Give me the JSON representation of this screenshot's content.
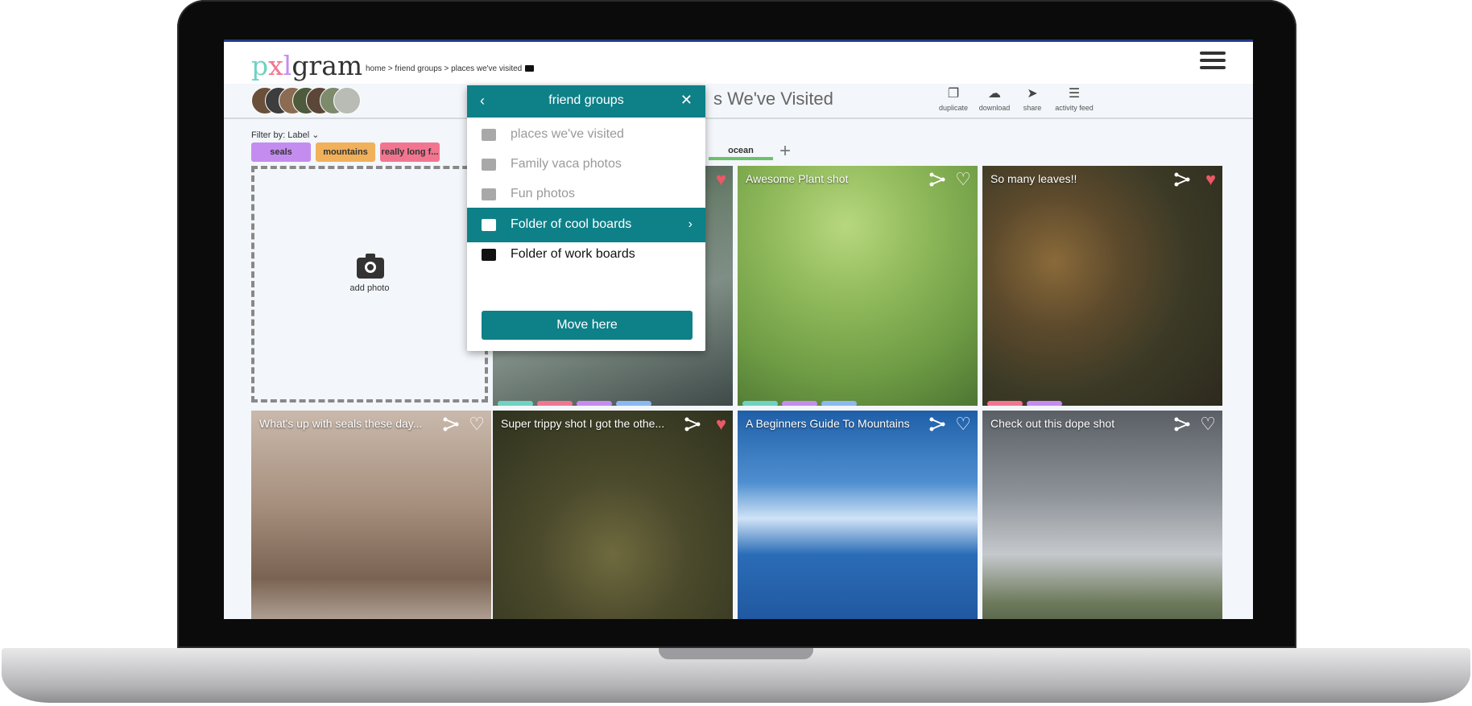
{
  "logo": {
    "p": "p",
    "x": "x",
    "l": "l",
    "g": "gram"
  },
  "breadcrumb": "home > friend groups > places we've visited",
  "board": {
    "title": "s We've Visited"
  },
  "toolbar": [
    {
      "label": "duplicate",
      "icon": "duplicate-icon"
    },
    {
      "label": "download",
      "icon": "cloud-download-icon"
    },
    {
      "label": "share",
      "icon": "share-icon"
    },
    {
      "label": "activity feed",
      "icon": "activity-feed-icon"
    }
  ],
  "filter": {
    "label": "Filter by: Label"
  },
  "labels": [
    {
      "text": "seals",
      "color": "#c58cf0"
    },
    {
      "text": "mountains",
      "color": "#f0b15a"
    },
    {
      "text": "really long f...",
      "color": "#f27590"
    },
    {
      "text": "ocean",
      "color": "#6cc26b"
    }
  ],
  "add_photo": {
    "label": "add photo"
  },
  "tiles": [
    {
      "title": "",
      "liked": true,
      "chips": [
        "#6fd2c2",
        "#f27590",
        "#c58cf0",
        "#8bb8f0"
      ]
    },
    {
      "title": "Awesome Plant shot",
      "liked": false,
      "chips": [
        "#6fd2c2",
        "#c58cf0",
        "#8bb8f0"
      ]
    },
    {
      "title": "So many leaves!!",
      "liked": true,
      "chips": [
        "#f27590",
        "#c58cf0"
      ]
    },
    {
      "title": "What's up with seals these day...",
      "liked": false,
      "chips": []
    },
    {
      "title": "Super trippy shot I got the othe...",
      "liked": true,
      "chips": []
    },
    {
      "title": "A Beginners Guide To Mountains",
      "liked": false,
      "chips": []
    },
    {
      "title": "Check out this dope shot",
      "liked": false,
      "chips": []
    }
  ],
  "popover": {
    "title": "friend groups",
    "items": [
      {
        "label": "places we've visited",
        "state": "dim",
        "icon": "image-icon"
      },
      {
        "label": "Family vaca photos",
        "state": "dim",
        "icon": "image-icon"
      },
      {
        "label": "Fun photos",
        "state": "dim",
        "icon": "image-icon"
      },
      {
        "label": "Folder of cool boards",
        "state": "sel",
        "icon": "folder-icon"
      },
      {
        "label": "Folder of work boards",
        "state": "dark",
        "icon": "folder-icon"
      }
    ],
    "move_button": "Move here"
  },
  "colors": {
    "teal": "#0e8088",
    "heart": "#ec5865",
    "accent_blue": "#1f3a8a"
  }
}
